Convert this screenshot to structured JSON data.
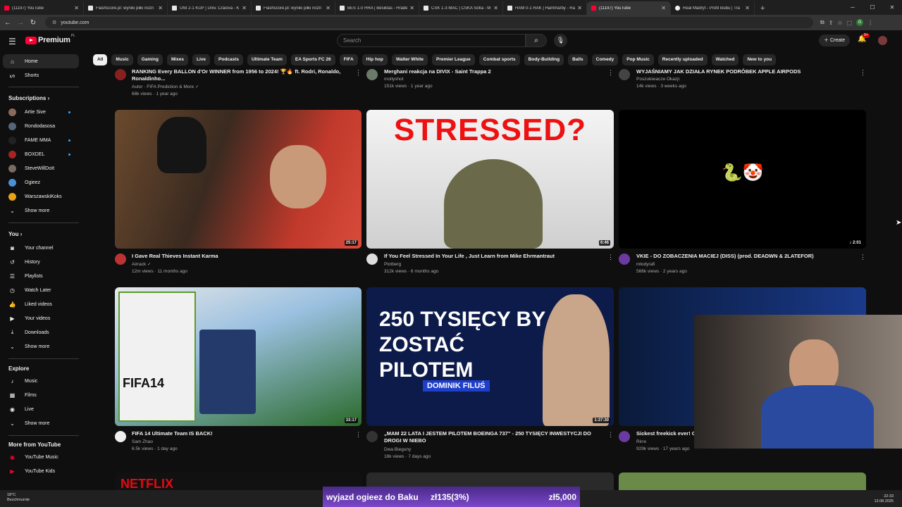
{
  "browser": {
    "tabs": [
      {
        "title": "(11197) YouTube",
        "icon": "youtube-favicon"
      },
      {
        "title": "Flashscore.pl: wyniki piłki nożn",
        "icon": "flashscore-favicon"
      },
      {
        "title": "UNI 2-1 KUP | Univ. Craiova - K",
        "icon": "flashscore-favicon"
      },
      {
        "title": "Flashscore.pl: wyniki piłki nożn",
        "icon": "flashscore-favicon"
      },
      {
        "title": "BES 1-0 HRA | Besiktas - Hradec",
        "icon": "flashscore-favicon"
      },
      {
        "title": "CSK 1-3 MAC | CSKA Sofia - M",
        "icon": "flashscore-favicon"
      },
      {
        "title": "HAM 0-1 RAK | Hammarby - Ra",
        "icon": "flashscore-favicon"
      },
      {
        "title": "(11197) YouTube",
        "icon": "youtube-favicon",
        "active": true
      },
      {
        "title": "Real Madryt - Profil klubu | Tra",
        "icon": "realmadrid-favicon"
      }
    ],
    "url": "youtube.com"
  },
  "header": {
    "logo_text": "Premium",
    "logo_region": "PL",
    "search_placeholder": "Search",
    "create_label": "Create",
    "notif_count": "9+"
  },
  "chips": [
    "All",
    "Music",
    "Gaming",
    "Mixes",
    "Live",
    "Podcasts",
    "Ultimate Team",
    "EA Sports FC 26",
    "FIFA",
    "Hip hop",
    "Walter White",
    "Premier League",
    "Combat sports",
    "Body-Building",
    "Balls",
    "Comedy",
    "Pop Music",
    "Recently uploaded",
    "Watched",
    "New to you"
  ],
  "sidebar": {
    "home": "Home",
    "shorts": "Shorts",
    "subscriptions_title": "Subscriptions",
    "subscriptions": [
      {
        "name": "Artie Sive",
        "color": "#8a6a5a",
        "live": true
      },
      {
        "name": "Rondodasosa",
        "color": "#556677",
        "live": false
      },
      {
        "name": "FAME MMA",
        "color": "#222222",
        "live": true
      },
      {
        "name": "BOXDEL",
        "color": "#aa2222",
        "live": true
      },
      {
        "name": "SteveWillDoIt",
        "color": "#7a6a60",
        "live": false
      },
      {
        "name": "Ogieez",
        "color": "#4a90d9",
        "live": false
      },
      {
        "name": "WarszawskiKoks",
        "color": "#e8a317",
        "live": false
      }
    ],
    "show_more": "Show more",
    "you_title": "You",
    "you_items": [
      "Your channel",
      "History",
      "Playlists",
      "Watch Later",
      "Liked videos",
      "Your videos",
      "Downloads",
      "Show more"
    ],
    "explore_title": "Explore",
    "explore_items": [
      "Music",
      "Films",
      "Live",
      "Show more"
    ],
    "more_title": "More from YouTube",
    "more_items": [
      "YouTube Music",
      "YouTube Kids"
    ]
  },
  "top_row": [
    {
      "title": "RANKING Every BALLON d'Or WINNER from 1956 to 2024! 🏆🔥 ft. Rodri, Ronaldo, Ronaldinho...",
      "channel": "Autor · FIFA Prediction & More ✓",
      "meta": "68k views · 1 year ago"
    },
    {
      "title": "Merghani reakcja na DIVIX - Saint Trappa 2",
      "channel": "mollyshot",
      "meta": "151k views · 1 year ago"
    },
    {
      "title": "WYJAŚNIAMY JAK DZIAŁA RYNEK PODRÓBEK APPLE AIRPODS",
      "channel": "Poszukiwacze Okazji",
      "meta": "14k views · 3 weeks ago"
    }
  ],
  "videos": [
    {
      "title": "I Gave Real Thieves Instant Karma",
      "channel": "Airrack ✓",
      "meta": "12m views · 11 months ago",
      "duration": "25:17"
    },
    {
      "title": "If You Feel Stressed In Your Life , Just Learn from Mike Ehrmantraut",
      "channel": "Plotberg",
      "meta": "312k views · 6 months ago",
      "duration": "6:46",
      "thumb_text": "STRESSED?"
    },
    {
      "title": "VKIE - DO ZOBACZENIA MACIEJ (DISS) (prod. DEADWN & 2LATEFOR)",
      "channel": "młodyrafi",
      "meta": "566k views · 2 years ago",
      "duration": "♪ 2:01",
      "thumb_text": "🐍🤡"
    },
    {
      "title": "FIFA 14 Ultimate Team IS BACK!",
      "channel": "Sam Zhao",
      "meta": "6.5k views · 1 day ago",
      "duration": "33:17",
      "thumb_text": "FIFA14"
    },
    {
      "title": "„MAM 22 LATA I JESTEM PILOTEM BOEINGA 737\" - 250 TYSIĘCY INWESTYCJI DO DROGI W NIEBO",
      "channel": "Dwa Bieguny",
      "meta": "18k views · 7 days ago",
      "duration": "1:37:30",
      "thumb_text": "250 TYSIĘCY BY ZOSTAĆ PILOTEM",
      "thumb_sub": "DOMINIK FILUŚ"
    },
    {
      "title": "Sickest freekick ever! G",
      "channel": "Rirre",
      "meta": "929k views · 17 years ago",
      "duration": ""
    }
  ],
  "overlay": {
    "donation_text": "wyjazd ogieez do Baku",
    "donation_amount": "zł135(3%)",
    "donation_goal": "zł5,000"
  },
  "taskbar": {
    "temp": "18°C",
    "weather": "Bezchmurnie",
    "time": "22:33",
    "date": "13.08.2025"
  }
}
